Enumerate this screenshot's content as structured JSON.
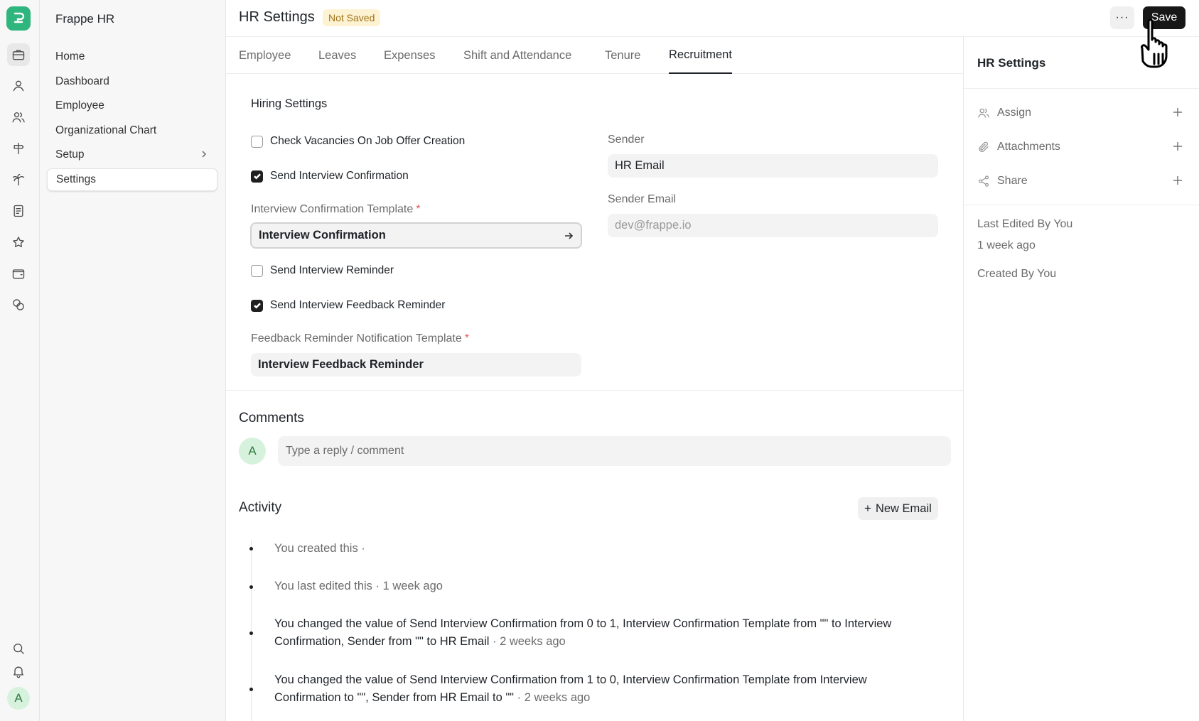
{
  "app": {
    "name": "Frappe HR"
  },
  "sidebar": {
    "items": [
      {
        "label": "Home"
      },
      {
        "label": "Dashboard"
      },
      {
        "label": "Employee"
      },
      {
        "label": "Organizational Chart"
      },
      {
        "label": "Setup"
      },
      {
        "label": "Settings"
      }
    ]
  },
  "rail": {
    "icons": [
      "briefcase-icon",
      "user-icon",
      "users-icon",
      "signpost-icon",
      "palm-tree-icon",
      "document-icon",
      "star-icon",
      "wallet-icon",
      "coins-icon",
      "search-icon",
      "bell-icon"
    ],
    "avatar_initial": "A"
  },
  "header": {
    "title": "HR Settings",
    "status_badge": "Not Saved",
    "more_label": "···",
    "save_label": "Save"
  },
  "tabs": [
    {
      "label": "Employee"
    },
    {
      "label": "Leaves"
    },
    {
      "label": "Expenses"
    },
    {
      "label": "Shift and Attendance"
    },
    {
      "label": "Tenure"
    },
    {
      "label": "Recruitment",
      "active": true
    }
  ],
  "form": {
    "section_title": "Hiring Settings",
    "check_vacancies": {
      "label": "Check Vacancies On Job Offer Creation",
      "checked": false
    },
    "send_interview_confirmation": {
      "label": "Send Interview Confirmation",
      "checked": true
    },
    "interview_confirmation_template": {
      "label": "Interview Confirmation Template",
      "required_mark": "*",
      "value": "Interview Confirmation"
    },
    "send_interview_reminder": {
      "label": "Send Interview Reminder",
      "checked": false
    },
    "send_interview_feedback_reminder": {
      "label": "Send Interview Feedback Reminder",
      "checked": true
    },
    "feedback_reminder_template": {
      "label": "Feedback Reminder Notification Template",
      "required_mark": "*",
      "value": "Interview Feedback Reminder"
    },
    "sender": {
      "label": "Sender",
      "value": "HR Email"
    },
    "sender_email": {
      "label": "Sender Email",
      "placeholder": "dev@frappe.io"
    }
  },
  "comments": {
    "title": "Comments",
    "avatar_initial": "A",
    "placeholder": "Type a reply / comment"
  },
  "activity": {
    "title": "Activity",
    "new_email_label": "New Email",
    "items": [
      {
        "text": "You created this ·"
      },
      {
        "text": "You last edited this · 1 week ago"
      },
      {
        "line1": "You changed the value of Send Interview Confirmation from 0 to 1, Interview Confirmation Template from \"\" to Interview",
        "line2": "Confirmation, Sender from \"\" to HR Email",
        "time": "· 2 weeks ago"
      },
      {
        "line1": "You changed the value of Send Interview Confirmation from 1 to 0, Interview Confirmation Template from Interview",
        "line2": "Confirmation to \"\", Sender from HR Email to \"\"",
        "time": "· 2 weeks ago"
      }
    ]
  },
  "right_panel": {
    "title": "HR Settings",
    "actions": [
      {
        "label": "Assign"
      },
      {
        "label": "Attachments"
      },
      {
        "label": "Share"
      }
    ],
    "last_edited_by": "Last Edited By You",
    "last_edited_time": "1 week ago",
    "created_by": "Created By You"
  },
  "colors": {
    "brand": "#2fb57e",
    "save_button": "#171717",
    "badge_bg": "#fdf3d2",
    "badge_text": "#a0741a"
  }
}
